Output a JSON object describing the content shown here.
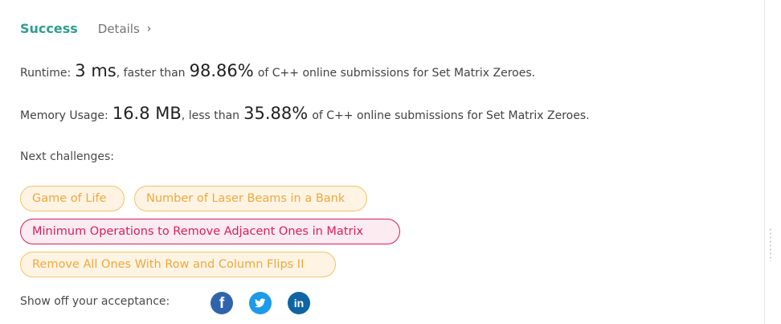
{
  "result": {
    "status": "Success",
    "details_label": "Details",
    "details_chevron": "›"
  },
  "runtime": {
    "label": "Runtime:",
    "value": "3 ms",
    "comparison_text": ", faster than",
    "percent": "98.86%",
    "suffix": "of C++ online submissions for Set Matrix Zeroes."
  },
  "memory": {
    "label": "Memory Usage:",
    "value": "16.8 MB",
    "comparison_text": ", less than",
    "percent": "35.88%",
    "suffix": "of C++ online submissions for Set Matrix Zeroes."
  },
  "next_challenges": {
    "label": "Next challenges:",
    "items": [
      {
        "title": "Game of Life",
        "difficulty": "medium"
      },
      {
        "title": "Number of Laser Beams in a Bank",
        "difficulty": "medium"
      },
      {
        "title": "Minimum Operations to Remove Adjacent Ones in Matrix",
        "difficulty": "hard"
      },
      {
        "title": "Remove All Ones With Row and Column Flips II",
        "difficulty": "medium"
      }
    ]
  },
  "share": {
    "label": "Show off your acceptance:",
    "icons": [
      {
        "name": "facebook-icon",
        "glyph": "f",
        "color": "#2f64ad"
      },
      {
        "name": "twitter-icon",
        "color": "#1d9ae9"
      },
      {
        "name": "linkedin-icon",
        "glyph": "in",
        "color": "#0f64a3"
      }
    ]
  },
  "colors": {
    "success": "#2e9e8f",
    "medium_text": "#f0a83d",
    "medium_border": "#f3c36b",
    "medium_background": "#fff4e3",
    "hard_text": "#d71f5d",
    "hard_border": "#d91e5d",
    "hard_background": "#fcebf1"
  }
}
